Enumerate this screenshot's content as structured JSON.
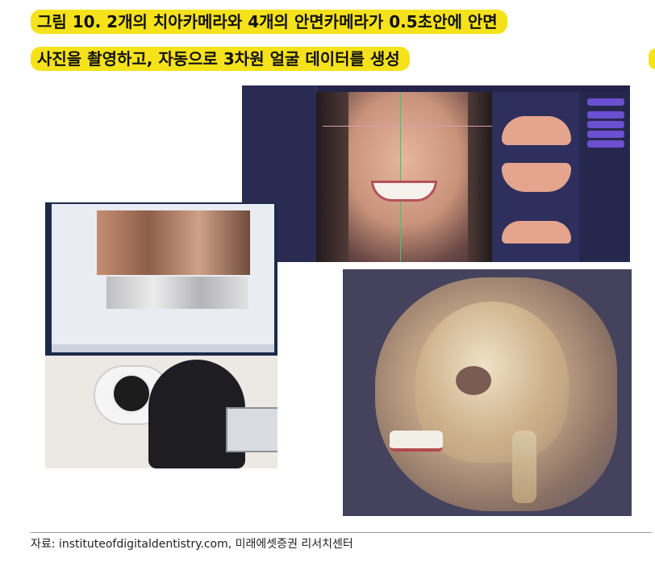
{
  "figure": {
    "title_line1": "그림 10. 2개의 치아카메라와 4개의 안면카메라가 0.5초안에 안면",
    "title_line2": "사진을 촬영하고, 자동으로 3차원 얼굴 데이터를 생성",
    "highlight_color": "#f6e21a"
  },
  "photos": [
    {
      "name": "dental-smile-design-software-screenshot"
    },
    {
      "name": "face-scanning-kiosk-photo"
    },
    {
      "name": "3d-face-skull-overlay-rendering"
    }
  ],
  "source": {
    "caption": "자료: instituteofdigitaldentistry.com, 미래에셋증권 리서치센터"
  }
}
